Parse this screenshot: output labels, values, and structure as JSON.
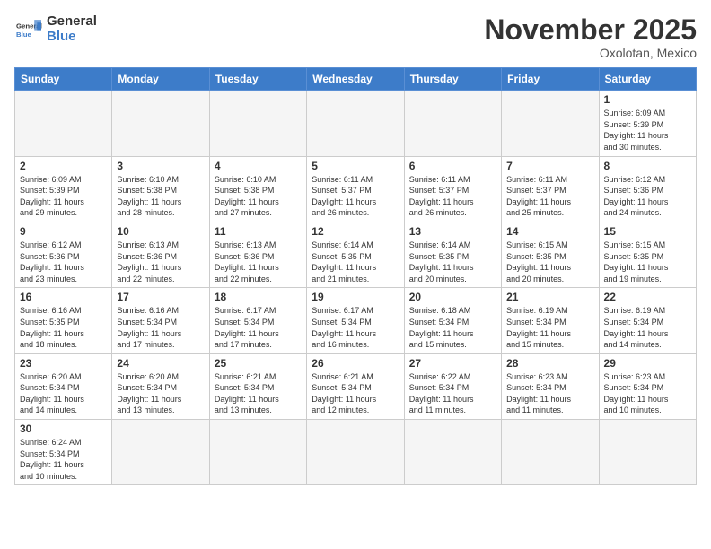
{
  "header": {
    "logo_general": "General",
    "logo_blue": "Blue",
    "month_title": "November 2025",
    "location": "Oxolotan, Mexico"
  },
  "weekdays": [
    "Sunday",
    "Monday",
    "Tuesday",
    "Wednesday",
    "Thursday",
    "Friday",
    "Saturday"
  ],
  "days": [
    {
      "num": "",
      "info": ""
    },
    {
      "num": "",
      "info": ""
    },
    {
      "num": "",
      "info": ""
    },
    {
      "num": "",
      "info": ""
    },
    {
      "num": "",
      "info": ""
    },
    {
      "num": "",
      "info": ""
    },
    {
      "num": "1",
      "info": "Sunrise: 6:09 AM\nSunset: 5:39 PM\nDaylight: 11 hours\nand 30 minutes."
    },
    {
      "num": "2",
      "info": "Sunrise: 6:09 AM\nSunset: 5:39 PM\nDaylight: 11 hours\nand 29 minutes."
    },
    {
      "num": "3",
      "info": "Sunrise: 6:10 AM\nSunset: 5:38 PM\nDaylight: 11 hours\nand 28 minutes."
    },
    {
      "num": "4",
      "info": "Sunrise: 6:10 AM\nSunset: 5:38 PM\nDaylight: 11 hours\nand 27 minutes."
    },
    {
      "num": "5",
      "info": "Sunrise: 6:11 AM\nSunset: 5:37 PM\nDaylight: 11 hours\nand 26 minutes."
    },
    {
      "num": "6",
      "info": "Sunrise: 6:11 AM\nSunset: 5:37 PM\nDaylight: 11 hours\nand 26 minutes."
    },
    {
      "num": "7",
      "info": "Sunrise: 6:11 AM\nSunset: 5:37 PM\nDaylight: 11 hours\nand 25 minutes."
    },
    {
      "num": "8",
      "info": "Sunrise: 6:12 AM\nSunset: 5:36 PM\nDaylight: 11 hours\nand 24 minutes."
    },
    {
      "num": "9",
      "info": "Sunrise: 6:12 AM\nSunset: 5:36 PM\nDaylight: 11 hours\nand 23 minutes."
    },
    {
      "num": "10",
      "info": "Sunrise: 6:13 AM\nSunset: 5:36 PM\nDaylight: 11 hours\nand 22 minutes."
    },
    {
      "num": "11",
      "info": "Sunrise: 6:13 AM\nSunset: 5:36 PM\nDaylight: 11 hours\nand 22 minutes."
    },
    {
      "num": "12",
      "info": "Sunrise: 6:14 AM\nSunset: 5:35 PM\nDaylight: 11 hours\nand 21 minutes."
    },
    {
      "num": "13",
      "info": "Sunrise: 6:14 AM\nSunset: 5:35 PM\nDaylight: 11 hours\nand 20 minutes."
    },
    {
      "num": "14",
      "info": "Sunrise: 6:15 AM\nSunset: 5:35 PM\nDaylight: 11 hours\nand 20 minutes."
    },
    {
      "num": "15",
      "info": "Sunrise: 6:15 AM\nSunset: 5:35 PM\nDaylight: 11 hours\nand 19 minutes."
    },
    {
      "num": "16",
      "info": "Sunrise: 6:16 AM\nSunset: 5:35 PM\nDaylight: 11 hours\nand 18 minutes."
    },
    {
      "num": "17",
      "info": "Sunrise: 6:16 AM\nSunset: 5:34 PM\nDaylight: 11 hours\nand 17 minutes."
    },
    {
      "num": "18",
      "info": "Sunrise: 6:17 AM\nSunset: 5:34 PM\nDaylight: 11 hours\nand 17 minutes."
    },
    {
      "num": "19",
      "info": "Sunrise: 6:17 AM\nSunset: 5:34 PM\nDaylight: 11 hours\nand 16 minutes."
    },
    {
      "num": "20",
      "info": "Sunrise: 6:18 AM\nSunset: 5:34 PM\nDaylight: 11 hours\nand 15 minutes."
    },
    {
      "num": "21",
      "info": "Sunrise: 6:19 AM\nSunset: 5:34 PM\nDaylight: 11 hours\nand 15 minutes."
    },
    {
      "num": "22",
      "info": "Sunrise: 6:19 AM\nSunset: 5:34 PM\nDaylight: 11 hours\nand 14 minutes."
    },
    {
      "num": "23",
      "info": "Sunrise: 6:20 AM\nSunset: 5:34 PM\nDaylight: 11 hours\nand 14 minutes."
    },
    {
      "num": "24",
      "info": "Sunrise: 6:20 AM\nSunset: 5:34 PM\nDaylight: 11 hours\nand 13 minutes."
    },
    {
      "num": "25",
      "info": "Sunrise: 6:21 AM\nSunset: 5:34 PM\nDaylight: 11 hours\nand 13 minutes."
    },
    {
      "num": "26",
      "info": "Sunrise: 6:21 AM\nSunset: 5:34 PM\nDaylight: 11 hours\nand 12 minutes."
    },
    {
      "num": "27",
      "info": "Sunrise: 6:22 AM\nSunset: 5:34 PM\nDaylight: 11 hours\nand 11 minutes."
    },
    {
      "num": "28",
      "info": "Sunrise: 6:23 AM\nSunset: 5:34 PM\nDaylight: 11 hours\nand 11 minutes."
    },
    {
      "num": "29",
      "info": "Sunrise: 6:23 AM\nSunset: 5:34 PM\nDaylight: 11 hours\nand 10 minutes."
    },
    {
      "num": "30",
      "info": "Sunrise: 6:24 AM\nSunset: 5:34 PM\nDaylight: 11 hours\nand 10 minutes."
    },
    {
      "num": "",
      "info": ""
    },
    {
      "num": "",
      "info": ""
    },
    {
      "num": "",
      "info": ""
    },
    {
      "num": "",
      "info": ""
    },
    {
      "num": "",
      "info": ""
    },
    {
      "num": "",
      "info": ""
    }
  ]
}
